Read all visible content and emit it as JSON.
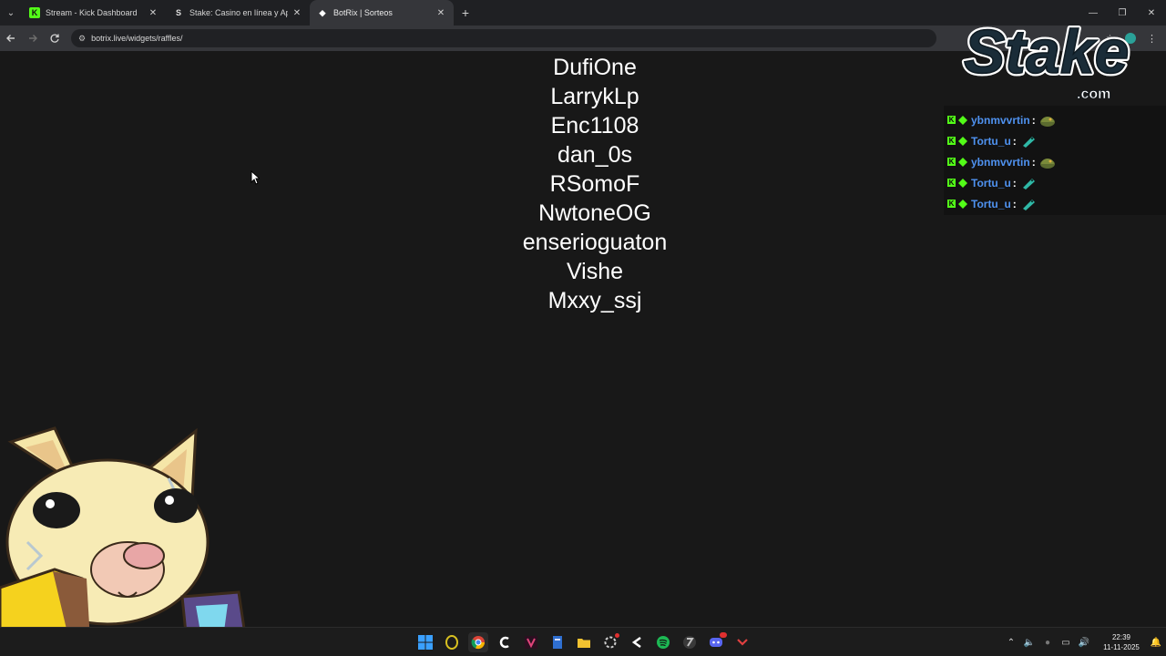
{
  "browser": {
    "tabs": [
      {
        "title": "Stream - Kick Dashboard",
        "favicon": "K",
        "favicon_color": "#53fc18",
        "active": false
      },
      {
        "title": "Stake: Casino en línea y Apuest",
        "favicon": "S",
        "favicon_color": "#e0e0e0",
        "active": false
      },
      {
        "title": "BotRix | Sorteos",
        "favicon": "◆",
        "favicon_color": "#ffffff",
        "active": true
      }
    ],
    "url": "botrix.live/widgets/raffles/"
  },
  "raffle": {
    "winners": [
      "DufiOne",
      "LarrykLp",
      "Enc1108",
      "dan_0s",
      "RSomoF",
      "NwtoneOG",
      "enserioguaton",
      "Vishe",
      "Mxxy_ssj"
    ]
  },
  "overlay": {
    "logo_text": "Stake",
    "logo_sub": ".com",
    "chat": [
      {
        "user": "ybnmvvrtin",
        "emote": "army-helmet-emote"
      },
      {
        "user": "Tortu_u",
        "emote": "teal-fish-emote"
      },
      {
        "user": "ybnmvvrtin",
        "emote": "army-helmet-emote"
      },
      {
        "user": "Tortu_u",
        "emote": "teal-fish-emote"
      },
      {
        "user": "Tortu_u",
        "emote": "teal-fish-emote"
      }
    ]
  },
  "taskbar": {
    "time": "22:39",
    "date": "11-11-2025"
  },
  "colors": {
    "kick_green": "#53fc18",
    "username_blue": "#4f92f0",
    "page_bg": "#181818"
  }
}
